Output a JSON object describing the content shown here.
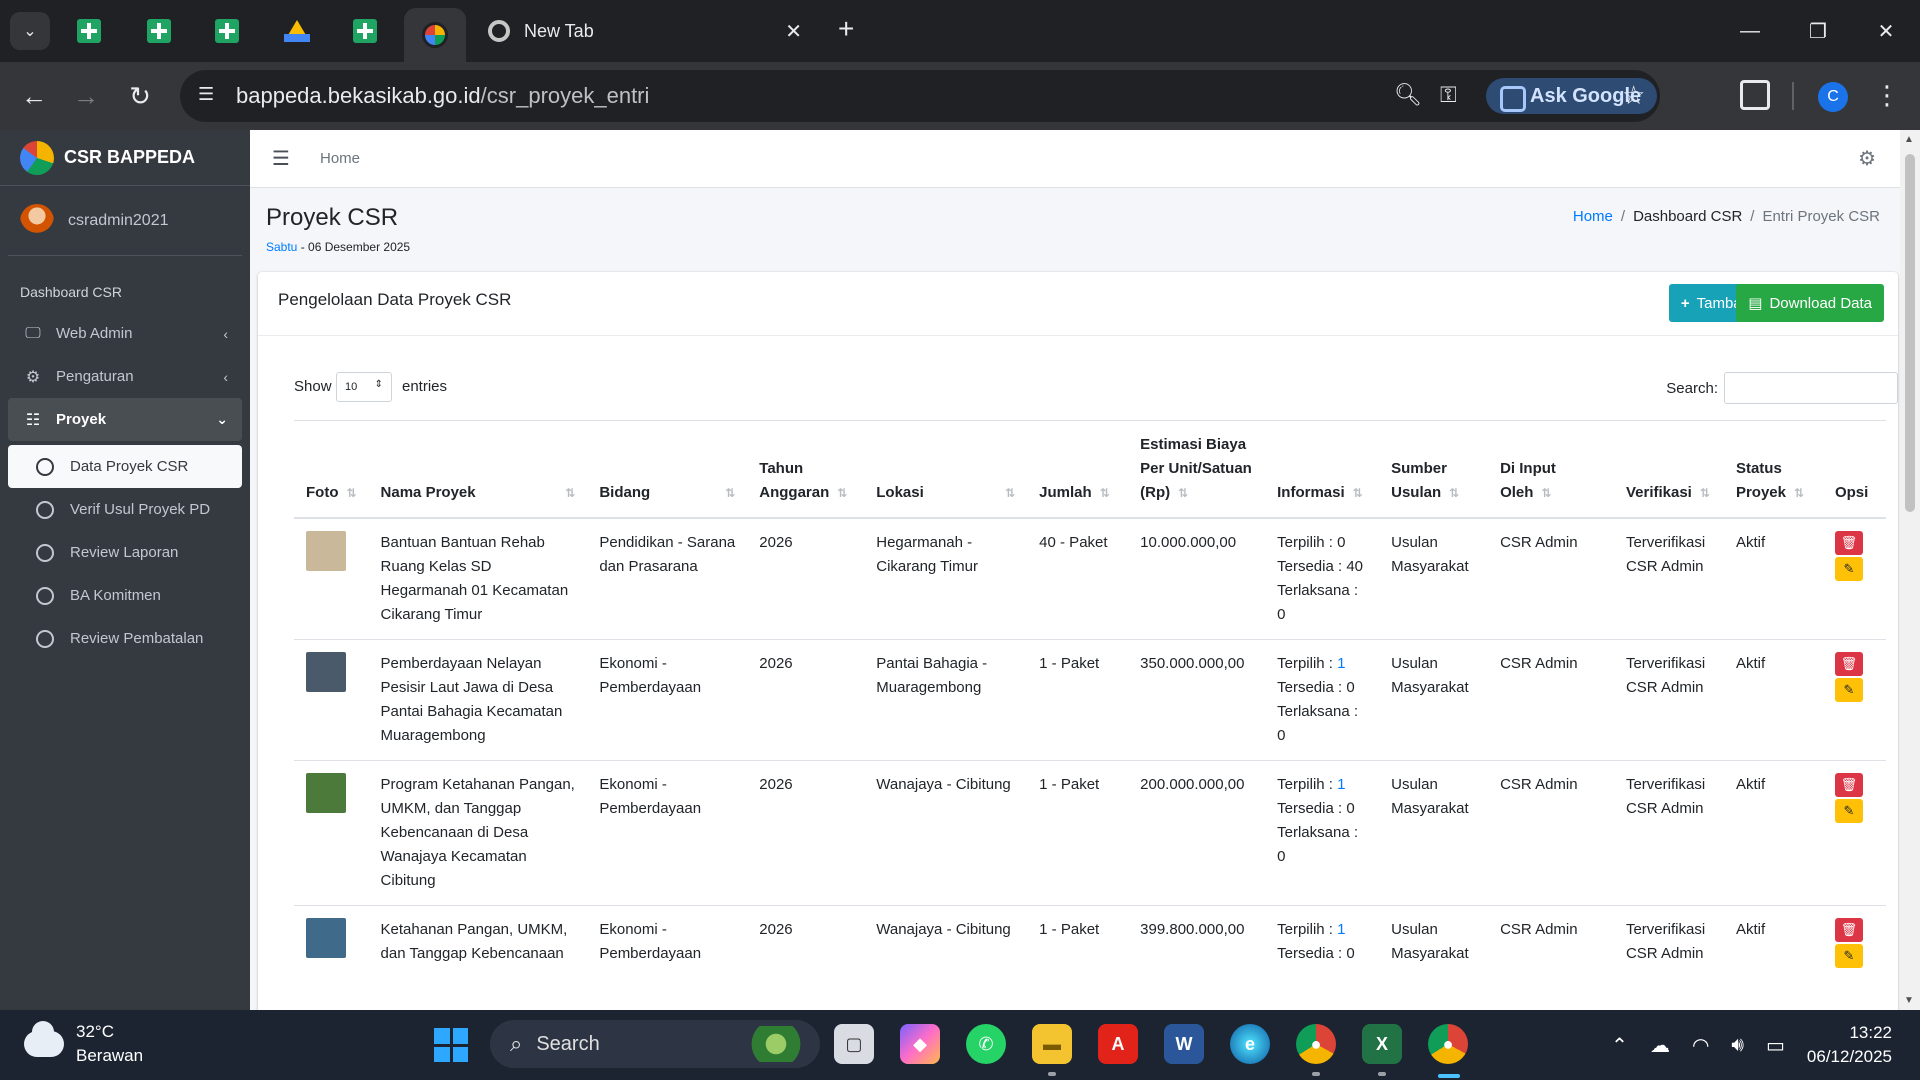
{
  "browser": {
    "tab_title": "New Tab",
    "url_host": "bappeda.bekasikab.go.id",
    "url_path": "/csr_proyek_entri",
    "ask_google": "Ask Google",
    "profile_initial": "C"
  },
  "sidebar": {
    "brand": "CSR BAPPEDA",
    "user": "csradmin2021",
    "header": "Dashboard CSR",
    "items": [
      {
        "label": "Web Admin",
        "icon": "monitor-icon"
      },
      {
        "label": "Pengaturan",
        "icon": "cogs-icon"
      },
      {
        "label": "Proyek",
        "icon": "grid-icon"
      }
    ],
    "subitems": [
      {
        "label": "Data Proyek CSR"
      },
      {
        "label": "Verif Usul Proyek PD"
      },
      {
        "label": "Review Laporan"
      },
      {
        "label": "BA Komitmen"
      },
      {
        "label": "Review Pembatalan"
      }
    ]
  },
  "topnav": {
    "home": "Home"
  },
  "page": {
    "title": "Proyek CSR",
    "day": "Sabtu",
    "date": " - 06 Desember 2025",
    "breadcrumb": {
      "home": "Home",
      "dashboard": "Dashboard CSR",
      "current": "Entri Proyek CSR"
    }
  },
  "card": {
    "title": "Pengelolaan Data Proyek CSR",
    "add_label": "Tambah",
    "download_label": "Download Data"
  },
  "table_controls": {
    "show": "Show",
    "entries_value": "10",
    "entries": "entries",
    "search": "Search:"
  },
  "table": {
    "headers": [
      "Foto",
      "Nama Proyek",
      "Bidang",
      "Tahun Anggaran",
      "Lokasi",
      "Jumlah",
      "Estimasi Biaya Per Unit/Satuan (Rp)",
      "Informasi",
      "Sumber Usulan",
      "Di Input Oleh",
      "Verifikasi",
      "Status Proyek",
      "Opsi"
    ],
    "rows": [
      {
        "nama": "Bantuan Bantuan Rehab Ruang Kelas SD Hegarmanah 01 Kecamatan Cikarang Timur",
        "bidang": "Pendidikan - Sarana dan Prasarana",
        "tahun": "2026",
        "lokasi": "Hegarmanah - Cikarang Timur",
        "jumlah": "40 - Paket",
        "biaya": "10.000.000,00",
        "terpilih_label": "Terpilih : ",
        "terpilih": "0",
        "tersedia": "Tersedia : 40",
        "terlaksana": "Terlaksana : 0",
        "sumber": "Usulan Masyarakat",
        "input": "CSR Admin",
        "verifikasi": "Terverifikasi CSR Admin",
        "status": "Aktif",
        "photo_color": "#c9b99a"
      },
      {
        "nama": "Pemberdayaan Nelayan Pesisir Laut Jawa di Desa Pantai Bahagia Kecamatan Muaragembong",
        "bidang": "Ekonomi - Pemberdayaan",
        "tahun": "2026",
        "lokasi": "Pantai Bahagia - Muaragembong",
        "jumlah": "1 - Paket",
        "biaya": "350.000.000,00",
        "terpilih_label": "Terpilih : ",
        "terpilih": "1",
        "tersedia": "Tersedia : 0",
        "terlaksana": "Terlaksana : 0",
        "sumber": "Usulan Masyarakat",
        "input": "CSR Admin",
        "verifikasi": "Terverifikasi CSR Admin",
        "status": "Aktif",
        "photo_color": "#4a5a6a"
      },
      {
        "nama": "Program Ketahanan Pangan, UMKM, dan Tanggap Kebencanaan di Desa Wanajaya Kecamatan Cibitung",
        "bidang": "Ekonomi - Pemberdayaan",
        "tahun": "2026",
        "lokasi": "Wanajaya - Cibitung",
        "jumlah": "1 - Paket",
        "biaya": "200.000.000,00",
        "terpilih_label": "Terpilih : ",
        "terpilih": "1",
        "tersedia": "Tersedia : 0",
        "terlaksana": "Terlaksana : 0",
        "sumber": "Usulan Masyarakat",
        "input": "CSR Admin",
        "verifikasi": "Terverifikasi CSR Admin",
        "status": "Aktif",
        "photo_color": "#4c7a3a"
      },
      {
        "nama": "Ketahanan Pangan, UMKM, dan Tanggap Kebencanaan",
        "bidang": "Ekonomi - Pemberdayaan",
        "tahun": "2026",
        "lokasi": "Wanajaya - Cibitung",
        "jumlah": "1 - Paket",
        "biaya": "399.800.000,00",
        "terpilih_label": "Terpilih : ",
        "terpilih": "1",
        "tersedia": "Tersedia : 0",
        "terlaksana": "",
        "sumber": "Usulan Masyarakat",
        "input": "CSR Admin",
        "verifikasi": "Terverifikasi CSR Admin",
        "status": "Aktif",
        "photo_color": "#3f6a8a"
      }
    ]
  },
  "taskbar": {
    "temp": "32°C",
    "weather": "Berawan",
    "search": "Search",
    "time": "13:22",
    "date": "06/12/2025"
  },
  "colors": {
    "sidebar_bg": "#343a40",
    "btn_info": "#17a2b8",
    "btn_success": "#28a745",
    "btn_danger": "#dc3545",
    "btn_warning": "#ffc107",
    "link": "#007bff"
  }
}
